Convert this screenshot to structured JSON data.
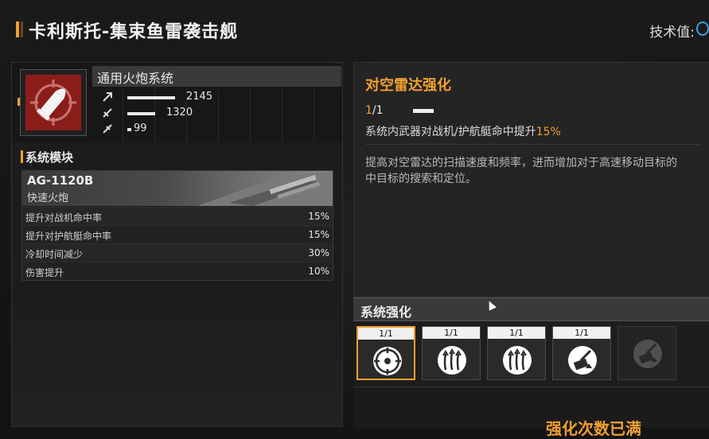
{
  "header": {
    "title": "卡利斯托-集束鱼雷袭击舰",
    "tech_label": "技术值:"
  },
  "system": {
    "name": "通用火炮系统",
    "stats": [
      {
        "icon": "damage-icon",
        "value": "2145",
        "fill": 0.6
      },
      {
        "icon": "armor-icon",
        "value": "1320",
        "fill": 0.35
      },
      {
        "icon": "speed-icon",
        "value": "99",
        "fill": 0.05
      }
    ]
  },
  "modules": {
    "title": "系统模块",
    "code": "AG-1120B",
    "subtitle": "快速火炮",
    "rows": [
      {
        "label": "提升对战机命中率",
        "value": "15%"
      },
      {
        "label": "提升对护航艇命中率",
        "value": "15%"
      },
      {
        "label": "冷却时间减少",
        "value": "30%"
      },
      {
        "label": "伤害提升",
        "value": "10%"
      }
    ]
  },
  "upgrade": {
    "title": "对空雷达强化",
    "level_current": "1",
    "level_rest": "/1",
    "effect_text": "系统内武器对战机/护航艇命中提升",
    "effect_value": "15%",
    "description_line1": "提高对空雷达的扫描速度和频率，进而增加对于高速移动目标的",
    "description_line2": "中目标的搜索和定位。"
  },
  "system_enhance": {
    "title": "系统强化",
    "slots": [
      {
        "level": "1/1",
        "icon": "radar-target-icon",
        "selected": true
      },
      {
        "level": "1/1",
        "icon": "triple-arrow-up-icon",
        "selected": false
      },
      {
        "level": "1/1",
        "icon": "triple-arrow-up-icon",
        "selected": false
      },
      {
        "level": "1/1",
        "icon": "turret-upgrade-icon",
        "selected": false
      },
      {
        "level": "",
        "icon": "turret-locked-icon",
        "selected": false
      }
    ]
  },
  "footer_text": "强化次数已满",
  "colors": {
    "accent": "#f0a030",
    "icon_red": "#8a1d1a"
  }
}
